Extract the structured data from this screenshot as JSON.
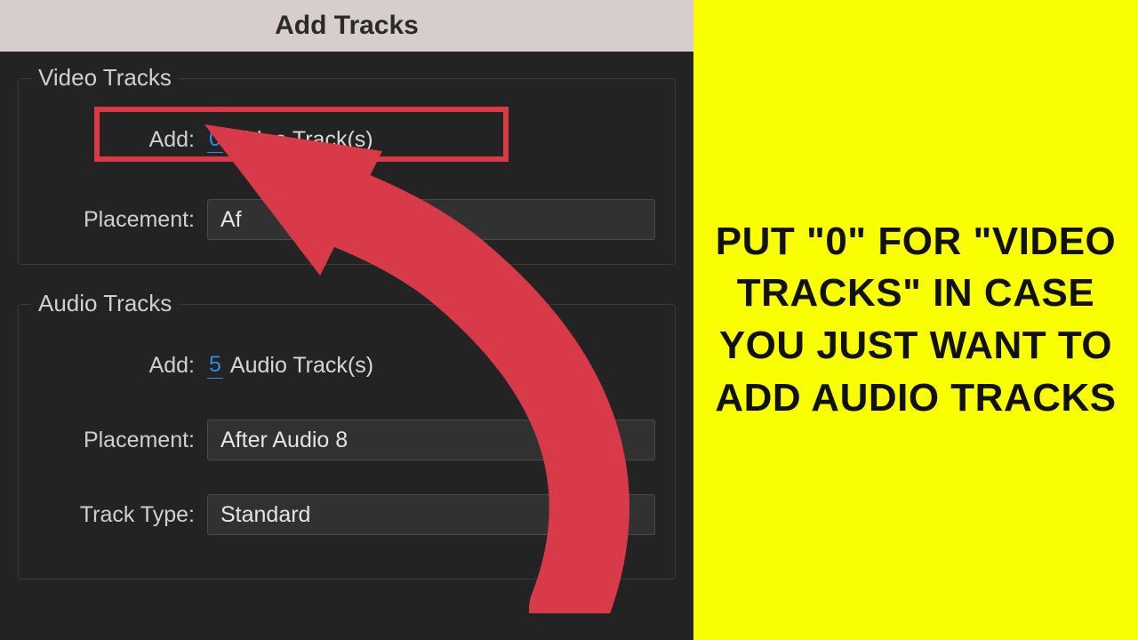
{
  "dialog": {
    "title": "Add Tracks",
    "video_group": {
      "legend": "Video Tracks",
      "add_label": "Add:",
      "add_value": "0",
      "add_suffix": "Video Track(s)",
      "placement_label": "Placement:",
      "placement_value_partial": "Af"
    },
    "audio_group": {
      "legend": "Audio Tracks",
      "add_label": "Add:",
      "add_value": "5",
      "add_suffix": "Audio Track(s)",
      "placement_label": "Placement:",
      "placement_value": "After Audio 8",
      "tracktype_label": "Track Type:",
      "tracktype_value": "Standard"
    }
  },
  "annotations": {
    "highlight_color": "#d93a45",
    "arrow_color": "#c83a4a"
  },
  "instruction": {
    "text": "PUT \"0\" FOR \"VIDEO TRACKS\" IN CASE YOU JUST WANT TO ADD AUDIO TRACKS",
    "bg": "#faff00"
  }
}
